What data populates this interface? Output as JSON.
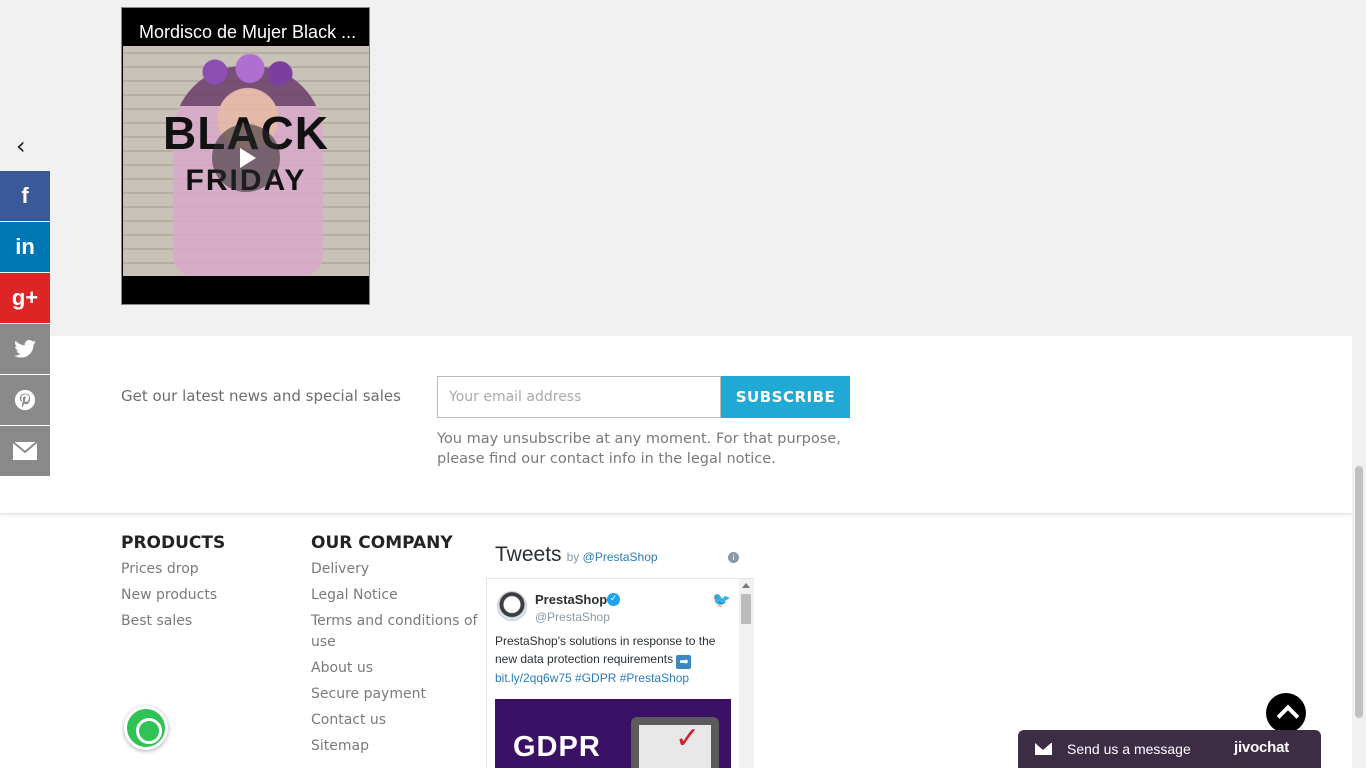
{
  "video": {
    "title": "Mordisco de Mujer Black ...",
    "overlay_line1": "BLACK",
    "overlay_line2": "FRIDAY"
  },
  "social": {
    "collapse_icon": "chevron-left-icon",
    "items": [
      {
        "name": "facebook",
        "glyph": "f",
        "color": "#3b5998"
      },
      {
        "name": "linkedin",
        "glyph": "in",
        "color": "#0077b5"
      },
      {
        "name": "google-plus",
        "glyph": "g+",
        "color": "#dd2525"
      },
      {
        "name": "twitter",
        "glyph": "🐦",
        "color": "#8a8a8a"
      },
      {
        "name": "pinterest",
        "glyph": "P",
        "color": "#8a8a8a"
      },
      {
        "name": "email",
        "glyph": "✉",
        "color": "#8a8a8a"
      }
    ]
  },
  "newsletter": {
    "label": "Get our latest news and special sales",
    "placeholder": "Your email address",
    "button": "SUBSCRIBE",
    "note": "You may unsubscribe at any moment. For that purpose, please find our contact info in the legal notice.",
    "accent": "#1fa9d4"
  },
  "footer": {
    "products": {
      "heading": "PRODUCTS",
      "links": [
        "Prices drop",
        "New products",
        "Best sales"
      ]
    },
    "company": {
      "heading": "OUR COMPANY",
      "links": [
        "Delivery",
        "Legal Notice",
        "Terms and conditions of use",
        "About us",
        "Secure payment",
        "Contact us",
        "Sitemap"
      ]
    }
  },
  "twitter": {
    "title": "Tweets",
    "by_prefix": "by",
    "by_handle": "@PrestaShop",
    "tweet": {
      "name": "PrestaShop",
      "handle": "@PrestaShop",
      "text": "PrestaShop's solutions in response to the new data protection requirements",
      "link": "bit.ly/2qq6w75 #GDPR #PrestaShop",
      "image_text": "GDPR"
    }
  },
  "jivochat": {
    "message": "Send us a message",
    "brand": "jivochat"
  }
}
